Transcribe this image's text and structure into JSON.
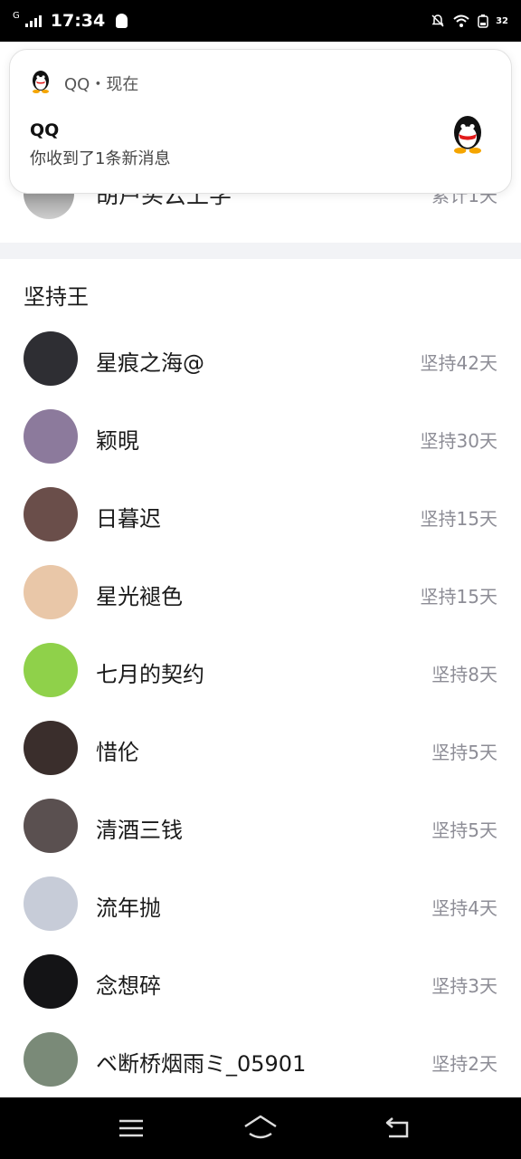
{
  "status_bar": {
    "network": "G",
    "time": "17:34",
    "battery": "32"
  },
  "notification": {
    "app_name": "QQ・现在",
    "title": "QQ",
    "body": "你收到了1条新消息"
  },
  "partial_row": {
    "name": "胡芦买云上学",
    "value": "累计1天"
  },
  "section_title": "坚持王",
  "leaderboard": [
    {
      "name": "星痕之海@",
      "streak": "坚持42天",
      "avatar_color": "#2e2e33"
    },
    {
      "name": "颖晛",
      "streak": "坚持30天",
      "avatar_color": "#8c7a9c"
    },
    {
      "name": "日暮迟",
      "streak": "坚持15天",
      "avatar_color": "#6a4e4a"
    },
    {
      "name": "星光褪色",
      "streak": "坚持15天",
      "avatar_color": "#e9c7a8"
    },
    {
      "name": "七月的契约",
      "streak": "坚持8天",
      "avatar_color": "#8fd14a"
    },
    {
      "name": "惜伦",
      "streak": "坚持5天",
      "avatar_color": "#3a2e2c"
    },
    {
      "name": "清酒三钱",
      "streak": "坚持5天",
      "avatar_color": "#5a5050"
    },
    {
      "name": "流年抛",
      "streak": "坚持4天",
      "avatar_color": "#c7ccd8"
    },
    {
      "name": "念想碎",
      "streak": "坚持3天",
      "avatar_color": "#141416"
    },
    {
      "name": "ベ断桥烟雨ミ_05901",
      "streak": "坚持2天",
      "avatar_color": "#7a8a78"
    }
  ],
  "colors": {
    "secondary_text": "#8d8d96",
    "divider_band": "#f2f3f6",
    "navbar": "#000000"
  },
  "icons": {
    "nav": [
      "menu-icon",
      "home-icon",
      "back-icon"
    ]
  }
}
